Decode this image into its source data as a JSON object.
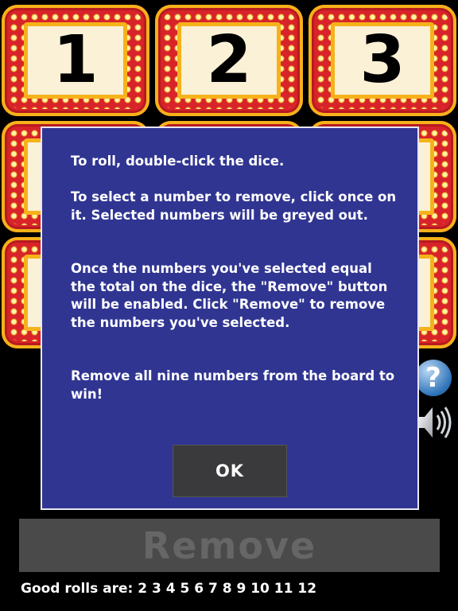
{
  "tiles": [
    "1",
    "2",
    "3",
    "",
    "",
    "",
    "",
    "",
    ""
  ],
  "help": {
    "icon": "question-icon",
    "glyph": "?"
  },
  "sound": {
    "icon": "speaker-icon"
  },
  "dialog": {
    "p1": "To roll, double-click the dice.",
    "p2": "To select a number to remove, click once on it.  Selected numbers will be greyed out.",
    "p3": "Once the numbers you've selected equal the total on the dice, the \"Remove\" button will be enabled. Click \"Remove\" to remove the numbers you've selected.",
    "p4": "Remove all nine numbers from the board to win!",
    "ok_label": "OK"
  },
  "remove_label": "Remove",
  "good_rolls": "Good rolls are: 2 3 4 5 6 7 8 9 10 11 12",
  "colors": {
    "tile_red": "#d8232a",
    "tile_gold": "#f6b21a",
    "dialog_blue": "#303592",
    "button_grey": "#4a4a4a"
  }
}
